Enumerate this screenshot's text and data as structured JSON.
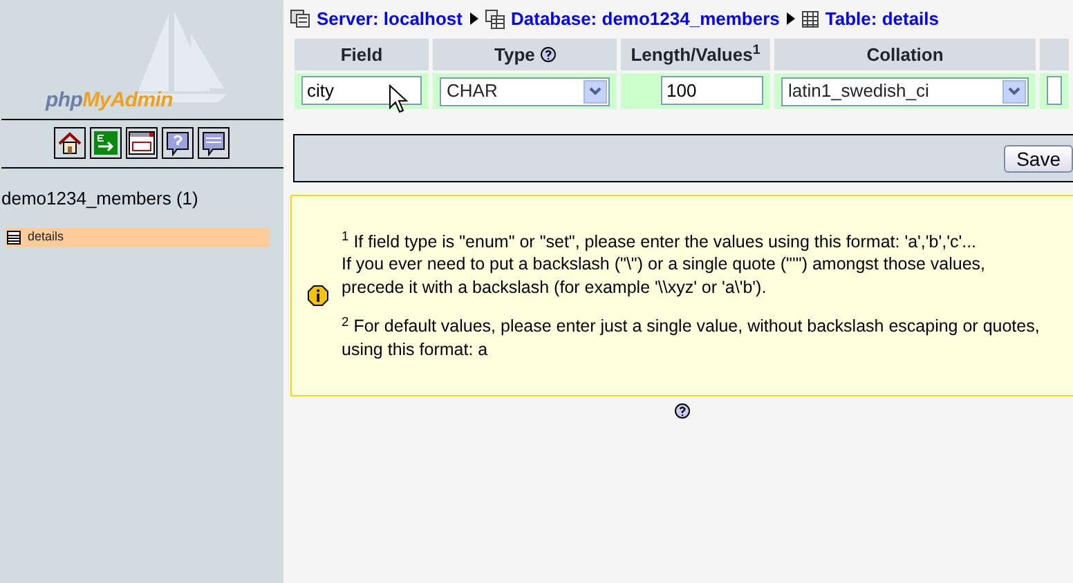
{
  "sidebar": {
    "logo": {
      "prefix": "php",
      "main": "MyAdmin"
    },
    "database": "demo1234_members (1)",
    "tables": [
      {
        "name": "details",
        "selected": true
      }
    ]
  },
  "breadcrumb": [
    {
      "kind": "server",
      "label": "Server: localhost"
    },
    {
      "kind": "database",
      "label": "Database: demo1234_members"
    },
    {
      "kind": "table",
      "label": "Table: details"
    }
  ],
  "structure_table": {
    "columns": [
      {
        "label": "Field",
        "help": false
      },
      {
        "label": "Type",
        "help": true
      },
      {
        "label": "Length/Values$^{1}$",
        "help": false
      },
      {
        "label": "Collation",
        "help": false
      }
    ],
    "row": {
      "field": "city",
      "type": "CHAR",
      "length": "100",
      "collation": "latin1_swedish_ci"
    }
  },
  "save_button": "Save",
  "notes": [
    {
      "lines": [
        "$^{1}$ If field type is \"enum\" or \"set\", please enter the values using this format: 'a','b','c'...",
        "If you ever need to put a backslash (\"\\\") or a single quote (\"'\") amongst those values,",
        "precede it with a backslash (for example '\\\\xyz' or 'a\\'b')."
      ]
    },
    {
      "lines": [
        "$^{2}$ For default values, please enter just a single value, without backslash escaping or quotes,",
        "using this format: a"
      ]
    }
  ]
}
